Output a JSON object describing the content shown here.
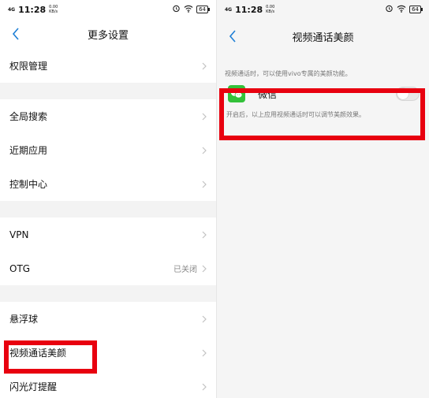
{
  "left": {
    "status": {
      "net": "4G",
      "time": "11:28",
      "speed": "0.00 KB/s",
      "battery": "64"
    },
    "header": {
      "title": "更多设置"
    },
    "items": [
      {
        "label": "权限管理"
      },
      {
        "label": "全局搜索"
      },
      {
        "label": "近期应用"
      },
      {
        "label": "控制中心"
      },
      {
        "label": "VPN"
      },
      {
        "label": "OTG",
        "value": "已关闭"
      },
      {
        "label": "悬浮球"
      },
      {
        "label": "视频通话美颜"
      },
      {
        "label": "闪光灯提醒"
      }
    ]
  },
  "right": {
    "status": {
      "net": "4G",
      "time": "11:28",
      "speed": "0.00 KB/s",
      "battery": "64"
    },
    "header": {
      "title": "视频通话美颜"
    },
    "description": "视频通话时，可以使用vivo专属的美颜功能。",
    "app": {
      "name": "微信",
      "enabled": false
    },
    "note": "开启后，以上应用视频通话时可以调节美颜效果。"
  },
  "colors": {
    "highlight": "#e8000f",
    "wechat_green": "#33c13a",
    "accent_blue": "#1e7fd6"
  }
}
